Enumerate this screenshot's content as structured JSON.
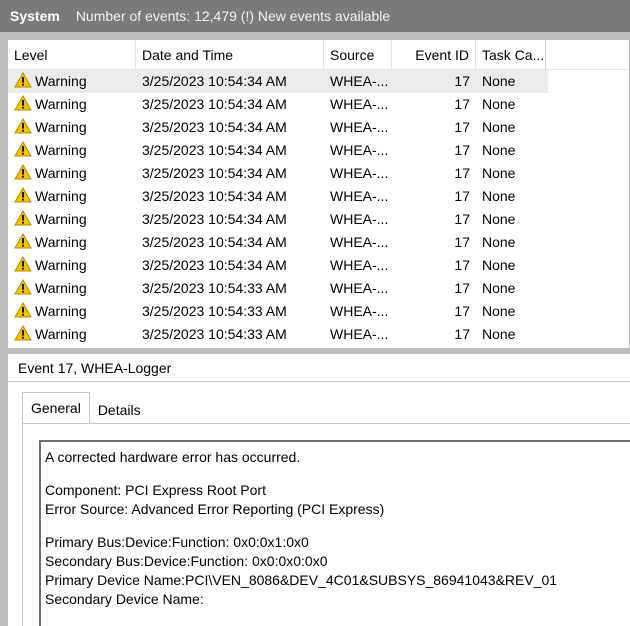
{
  "header": {
    "log_name": "System",
    "event_count": "Number of events: 12,479 (!) New events available"
  },
  "columns": {
    "level": "Level",
    "date": "Date and Time",
    "source": "Source",
    "event_id": "Event ID",
    "task": "Task Ca..."
  },
  "rows": [
    {
      "level": "Warning",
      "date": "3/25/2023 10:54:34 AM",
      "source": "WHEA-...",
      "id": "17",
      "task": "None"
    },
    {
      "level": "Warning",
      "date": "3/25/2023 10:54:34 AM",
      "source": "WHEA-...",
      "id": "17",
      "task": "None"
    },
    {
      "level": "Warning",
      "date": "3/25/2023 10:54:34 AM",
      "source": "WHEA-...",
      "id": "17",
      "task": "None"
    },
    {
      "level": "Warning",
      "date": "3/25/2023 10:54:34 AM",
      "source": "WHEA-...",
      "id": "17",
      "task": "None"
    },
    {
      "level": "Warning",
      "date": "3/25/2023 10:54:34 AM",
      "source": "WHEA-...",
      "id": "17",
      "task": "None"
    },
    {
      "level": "Warning",
      "date": "3/25/2023 10:54:34 AM",
      "source": "WHEA-...",
      "id": "17",
      "task": "None"
    },
    {
      "level": "Warning",
      "date": "3/25/2023 10:54:34 AM",
      "source": "WHEA-...",
      "id": "17",
      "task": "None"
    },
    {
      "level": "Warning",
      "date": "3/25/2023 10:54:34 AM",
      "source": "WHEA-...",
      "id": "17",
      "task": "None"
    },
    {
      "level": "Warning",
      "date": "3/25/2023 10:54:34 AM",
      "source": "WHEA-...",
      "id": "17",
      "task": "None"
    },
    {
      "level": "Warning",
      "date": "3/25/2023 10:54:33 AM",
      "source": "WHEA-...",
      "id": "17",
      "task": "None"
    },
    {
      "level": "Warning",
      "date": "3/25/2023 10:54:33 AM",
      "source": "WHEA-...",
      "id": "17",
      "task": "None"
    },
    {
      "level": "Warning",
      "date": "3/25/2023 10:54:33 AM",
      "source": "WHEA-...",
      "id": "17",
      "task": "None"
    }
  ],
  "detail": {
    "title": "Event 17, WHEA-Logger",
    "tabs": [
      "General",
      "Details"
    ],
    "lines": [
      "A corrected hardware error has occurred.",
      "Component: PCI Express Root Port",
      "Error Source: Advanced Error Reporting (PCI Express)",
      "Primary Bus:Device:Function: 0x0:0x1:0x0",
      "Secondary Bus:Device:Function: 0x0:0x0:0x0",
      "Primary Device Name:PCI\\VEN_8086&DEV_4C01&SUBSYS_86941043&REV_01",
      "Secondary Device Name:"
    ]
  },
  "icons": {
    "row_level": "warning-icon"
  },
  "colors": {
    "titlebar": "#7a7a7a",
    "warning_fill": "#f5c400",
    "selected_row": "#ebebeb"
  }
}
